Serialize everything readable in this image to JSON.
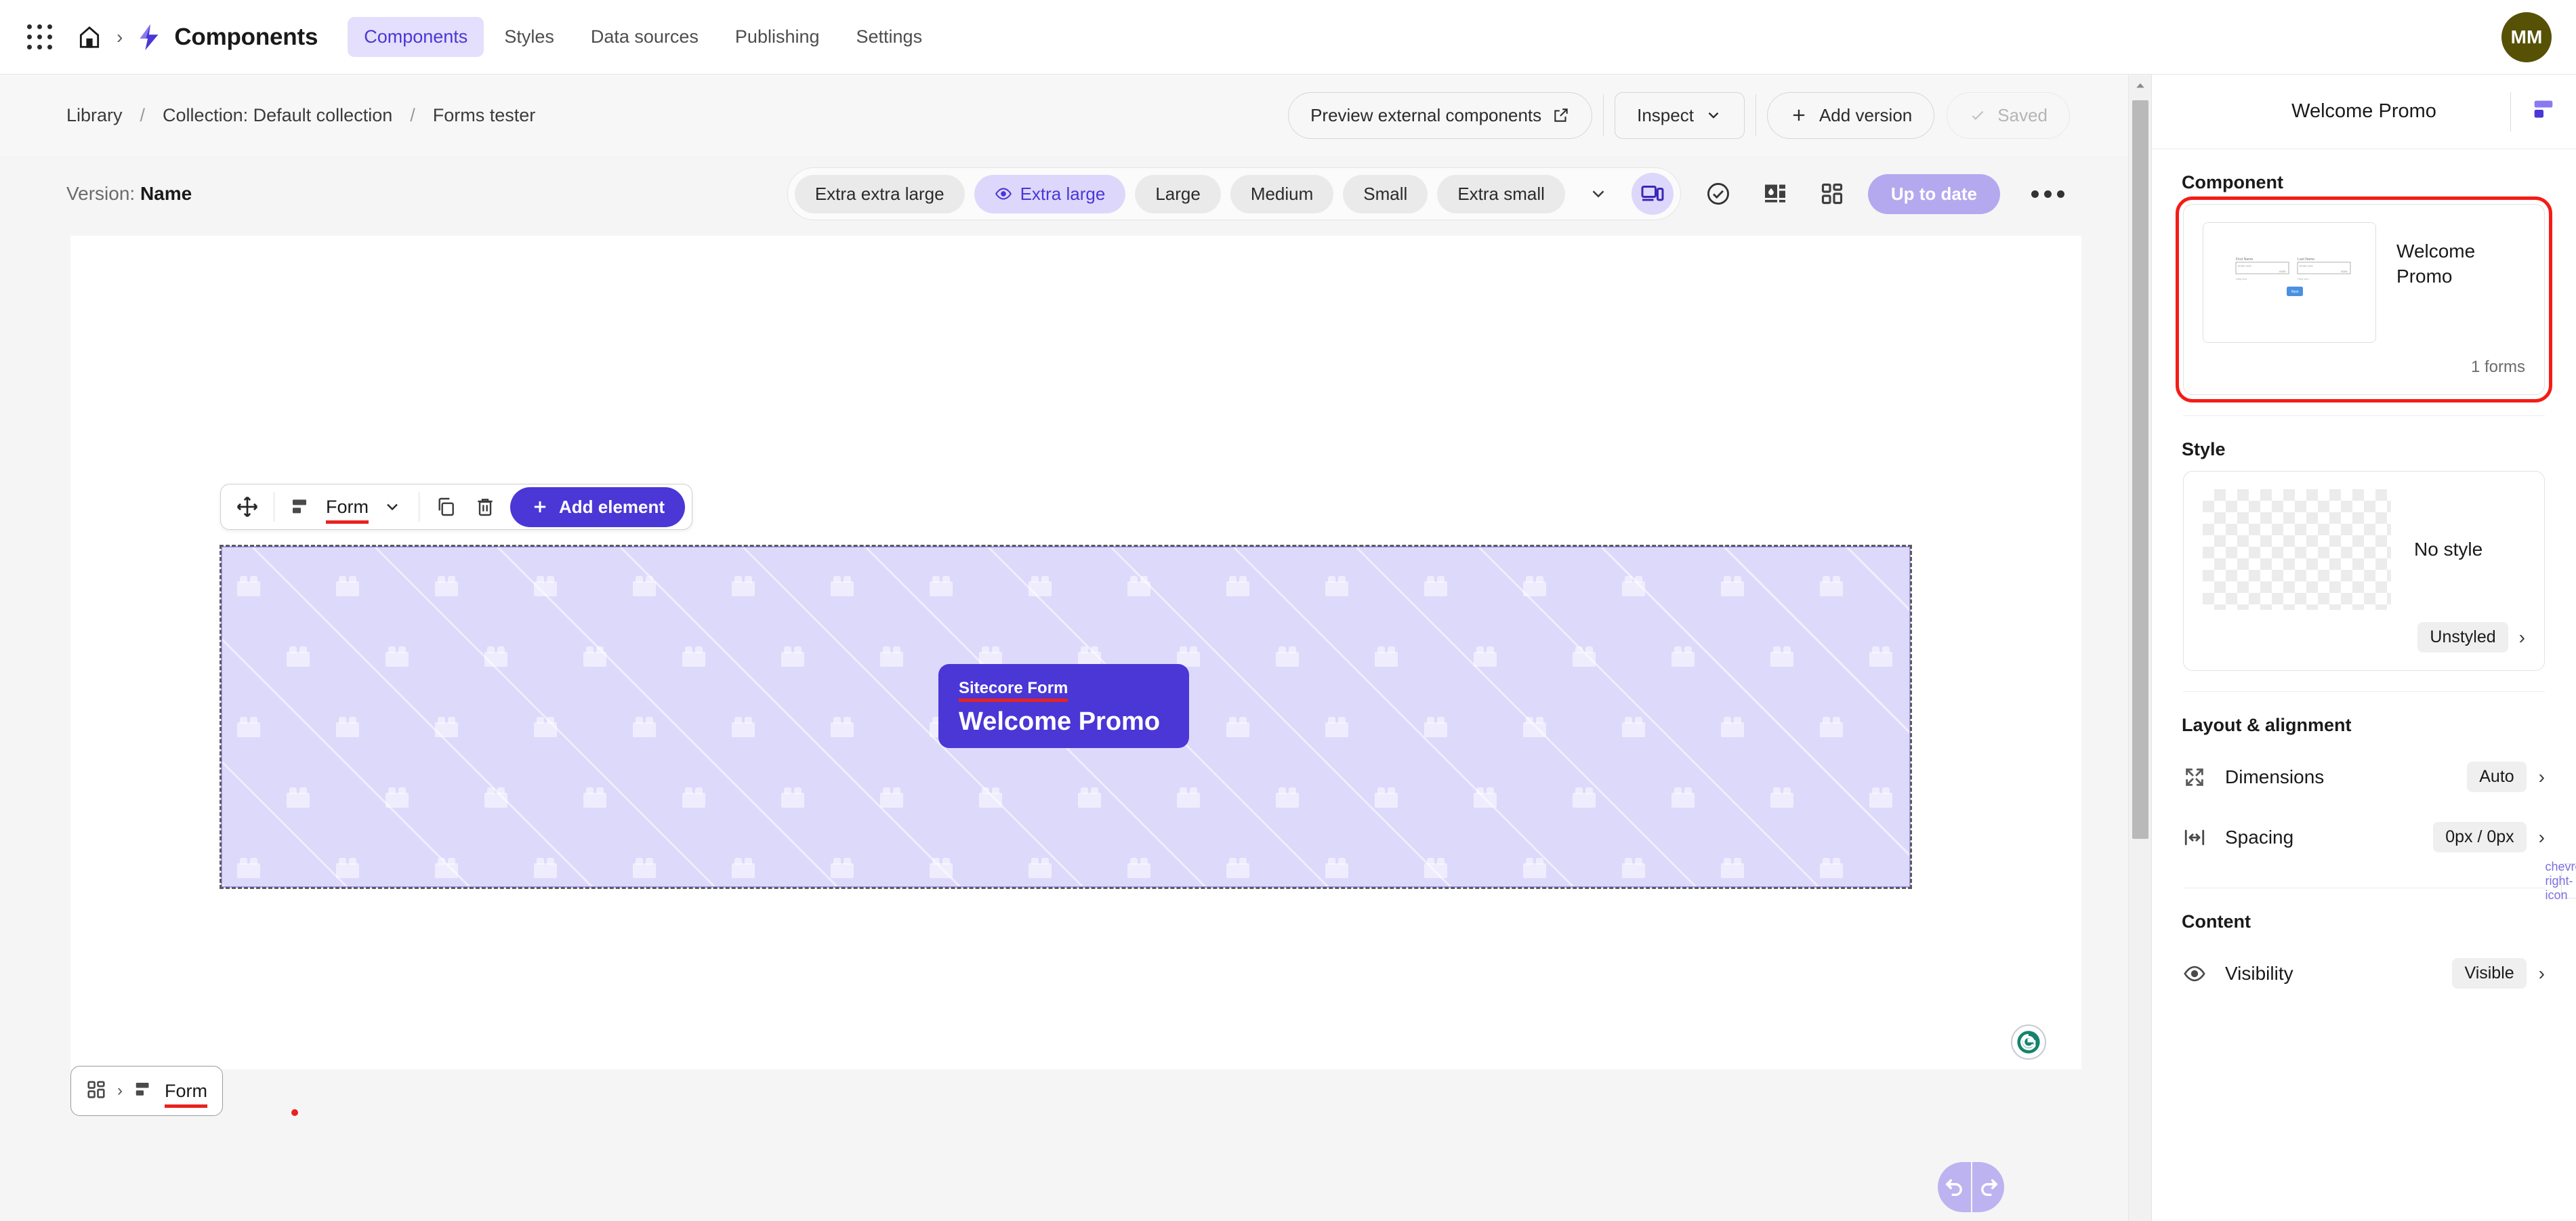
{
  "topbar": {
    "apps_icon": "waffle-grid-icon",
    "home_icon": "home-icon",
    "breadcrumb_chevron": "›",
    "brand": "Components",
    "nav": [
      {
        "label": "Components",
        "active": true
      },
      {
        "label": "Styles",
        "active": false
      },
      {
        "label": "Data sources",
        "active": false
      },
      {
        "label": "Publishing",
        "active": false
      },
      {
        "label": "Settings",
        "active": false
      }
    ],
    "avatar_initials": "MM",
    "avatar_color": "#575106"
  },
  "subbar": {
    "breadcrumbs": [
      {
        "label": "Library"
      },
      {
        "label": "Collection: Default collection"
      },
      {
        "label": "Forms tester"
      }
    ],
    "separator": "/",
    "actions": {
      "preview_label": "Preview external components",
      "preview_icon": "external-link-icon",
      "inspect_label": "Inspect",
      "inspect_icon": "chevron-down-icon",
      "add_version_label": "Add version",
      "add_version_icon": "plus-icon",
      "saved_label": "Saved",
      "saved_icon": "check-icon"
    }
  },
  "editbar": {
    "version_prefix": "Version:",
    "version_name": "Name",
    "breakpoints": [
      {
        "label": "Extra extra large",
        "selected": false
      },
      {
        "label": "Extra large",
        "selected": true
      },
      {
        "label": "Large",
        "selected": false
      },
      {
        "label": "Medium",
        "selected": false
      },
      {
        "label": "Small",
        "selected": false
      },
      {
        "label": "Extra small",
        "selected": false
      }
    ],
    "breakpoint_caret": "chevron-down-icon",
    "tools": [
      {
        "name": "responsive-devices-icon",
        "selected": true
      },
      {
        "name": "check-circle-icon",
        "selected": false
      },
      {
        "name": "image-layout-icon",
        "selected": false
      },
      {
        "name": "components-grid-icon",
        "selected": false
      }
    ],
    "status_label": "Up to date",
    "status_color": "#b4a9ef",
    "more_icon": "more-horizontal-icon"
  },
  "element_toolbar": {
    "move_icon": "move-arrows-icon",
    "type_icon": "form-layout-icon",
    "type_label": "Form",
    "type_caret": "chevron-down-icon",
    "duplicate_icon": "copy-icon",
    "delete_icon": "trash-icon",
    "add_element_label": "Add element",
    "add_element_icon": "plus-icon",
    "accent_color": "#4a37d6"
  },
  "canvas": {
    "region_bg": "#ddd9fb",
    "promo": {
      "eyebrow": "Sitecore Form",
      "title": "Welcome Promo",
      "bg_color": "#4a37d6"
    },
    "grammarly_icon": "grammarly-icon"
  },
  "bottom_bar": {
    "root_icon": "components-grid-icon",
    "separator": "›",
    "node_icon": "form-layout-icon",
    "node_label": "Form",
    "undo_icon": "undo-icon",
    "redo_icon": "redo-icon"
  },
  "panel": {
    "title": "Welcome Promo",
    "layout_icon": "layout-blocks-icon",
    "component": {
      "section_label": "Component",
      "thumbnail_icon": "form-preview-thumbnail",
      "name": "Welcome Promo",
      "meta": "1 forms",
      "selected_outline_color": "#f51b16"
    },
    "style": {
      "section_label": "Style",
      "swatch_icon": "transparent-checker-swatch",
      "name": "No style",
      "value": "Unstyled",
      "chevron": "›"
    },
    "layout_alignment": {
      "section_label": "Layout & alignment",
      "rows": [
        {
          "icon": "dimensions-expand-icon",
          "label": "Dimensions",
          "value": "Auto",
          "chevron": "›"
        },
        {
          "icon": "spacing-horizontal-icon",
          "label": "Spacing",
          "value": "0px / 0px",
          "chevron": "›"
        }
      ]
    },
    "content": {
      "section_label": "Content",
      "rows": [
        {
          "icon": "eye-icon",
          "label": "Visibility",
          "value": "Visible",
          "chevron": "›"
        }
      ]
    },
    "side_handle_icon": "chevron-right-icon",
    "scrollbar": {
      "up_arrow": "chevron-up-icon"
    }
  }
}
